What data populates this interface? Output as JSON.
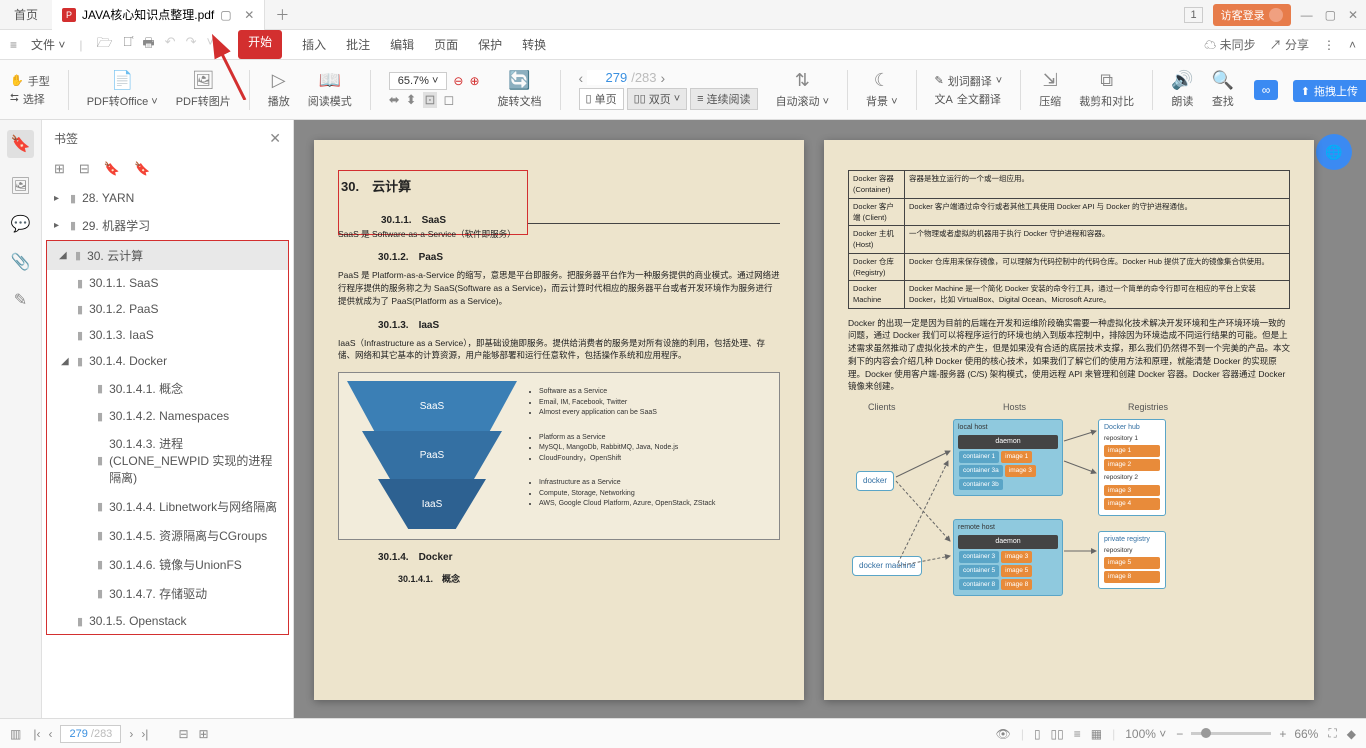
{
  "titlebar": {
    "home": "首页",
    "filename": "JAVA核心知识点整理.pdf",
    "login": "访客登录",
    "badge": "1"
  },
  "menubar": {
    "file": "文件",
    "tabs": {
      "start": "开始",
      "insert": "插入",
      "annotate": "批注",
      "edit": "编辑",
      "page": "页面",
      "protect": "保护",
      "convert": "转换"
    },
    "unsync": "未同步",
    "share": "分享"
  },
  "ribbon": {
    "hand": "手型",
    "select": "选择",
    "pdf2office": "PDF转Office",
    "pdf2img": "PDF转图片",
    "play": "播放",
    "readmode": "阅读模式",
    "zoom": "65.7%",
    "rotate": "旋转文档",
    "page_current": "279",
    "page_total": "/283",
    "single": "单页",
    "double": "双页",
    "continuous": "连续阅读",
    "autoscroll": "自动滚动",
    "bg": "背景",
    "trans_sel": "划词翻译",
    "trans_full": "全文翻译",
    "compress": "压缩",
    "crop": "裁剪和对比",
    "read": "朗读",
    "search": "查找",
    "upload": "拖拽上传"
  },
  "sidebar": {
    "title": "书签",
    "items": [
      {
        "label": "28. YARN",
        "lvl": 1,
        "arrow": "▸"
      },
      {
        "label": "29. 机器学习",
        "lvl": 1,
        "arrow": "▸"
      },
      {
        "label": "30. 云计算",
        "lvl": 1,
        "arrow": "▾",
        "active": true
      },
      {
        "label": "30.1.1. SaaS",
        "lvl": 2
      },
      {
        "label": "30.1.2. PaaS",
        "lvl": 2
      },
      {
        "label": "30.1.3. IaaS",
        "lvl": 2
      },
      {
        "label": "30.1.4. Docker",
        "lvl": 2,
        "arrow": "▾"
      },
      {
        "label": "30.1.4.1. 概念",
        "lvl": 3
      },
      {
        "label": "30.1.4.2. Namespaces",
        "lvl": 3
      },
      {
        "label": "30.1.4.3. 进程(CLONE_NEWPID 实现的进程隔离)",
        "lvl": 3
      },
      {
        "label": "30.1.4.4. Libnetwork与网络隔离",
        "lvl": 3
      },
      {
        "label": "30.1.4.5. 资源隔离与CGroups",
        "lvl": 3
      },
      {
        "label": "30.1.4.6. 镜像与UnionFS",
        "lvl": 3
      },
      {
        "label": "30.1.4.7. 存储驱动",
        "lvl": 3
      },
      {
        "label": "30.1.5. Openstack",
        "lvl": 2
      }
    ]
  },
  "page1": {
    "h": "30.　云计算",
    "s1": "30.1.1.　SaaS",
    "p1": "SaaS 是 Software-as-a-Service（软件即服务）",
    "s2": "30.1.2.　PaaS",
    "p2": "PaaS 是 Platform-as-a-Service 的缩写，意思是平台即服务。把服务器平台作为一种服务提供的商业模式。通过网络进行程序提供的服务称之为 SaaS(Software as a Service)，而云计算时代相应的服务器平台或者开发环境作为服务进行提供就成为了 PaaS(Platform as a Service)。",
    "s3": "30.1.3.　IaaS",
    "p3": "IaaS（Infrastructure as a Service），即基础设施即服务。提供给消费者的服务是对所有设施的利用，包括处理、存储、网络和其它基本的计算资源，用户能够部署和运行任意软件，包括操作系统和应用程序。",
    "pyr": {
      "top": "SaaS",
      "mid": "PaaS",
      "bot": "IaaS"
    },
    "pyr_desc": {
      "top": [
        "Software as a Service",
        "Email, IM, Facebook, Twitter",
        "Almost every application can be SaaS"
      ],
      "mid": [
        "Platform as a Service",
        "MySQL, MangoDb, RabbitMQ, Java, Node.js",
        "CloudFoundry，OpenShift"
      ],
      "bot": [
        "Infrastructure as a Service",
        "Compute, Storage, Networking",
        "AWS, Google Cloud Platform, Azure, OpenStack, ZStack"
      ]
    },
    "s4": "30.1.4.　Docker",
    "s5": "30.1.4.1.　概念"
  },
  "page2": {
    "table": [
      [
        "Docker 容器 (Container)",
        "容器是独立运行的一个或一组应用。"
      ],
      [
        "Docker 客户端 (Client)",
        "Docker 客户端通过命令行或者其他工具使用 Docker API 与 Docker 的守护进程通信。"
      ],
      [
        "Docker 主机 (Host)",
        "一个物理或者虚拟的机器用于执行 Docker 守护进程和容器。"
      ],
      [
        "Docker 仓库 (Registry)",
        "Docker 仓库用来保存镜像，可以理解为代码控制中的代码仓库。Docker Hub 提供了庞大的镜像集合供使用。"
      ],
      [
        "Docker Machine",
        "Docker Machine 是一个简化 Docker 安装的命令行工具，通过一个简单的命令行即可在相应的平台上安装 Docker，比如 VirtualBox、Digital Ocean、Microsoft Azure。"
      ]
    ],
    "para": "Docker 的出现一定是因为目前的后端在开发和运维阶段确实需要一种虚拟化技术解决开发环境和生产环境环境一致的问题，通过 Docker 我们可以将程序运行的环境也纳入到版本控制中，排除因为环境造成不同运行结果的可能。但是上述需求虽然推动了虚拟化技术的产生，但是如果没有合适的底层技术支撑，那么我们仍然得不到一个完美的产品。本文剩下的内容会介绍几种 Docker 使用的核心技术，如果我们了解它们的使用方法和原理，就能清楚 Docker 的实现原理。Docker 使用客户端-服务器 (C/S) 架构模式，使用远程 API 来管理和创建 Docker 容器。Docker 容器通过 Docker 镜像来创建。",
    "dia": {
      "clients": "Clients",
      "hosts": "Hosts",
      "registries": "Registries",
      "docker": "docker",
      "machine": "docker machine",
      "localhost": "local host",
      "remotehost": "remote host",
      "daemon": "daemon",
      "hub": "Docker hub",
      "rep1": "repository 1",
      "rep2": "repository 2",
      "priv": "private registry",
      "rep": "repository"
    }
  },
  "statusbar": {
    "page_current": "279",
    "page_total": "/283",
    "ratio": "100%",
    "zoom": "66%"
  }
}
